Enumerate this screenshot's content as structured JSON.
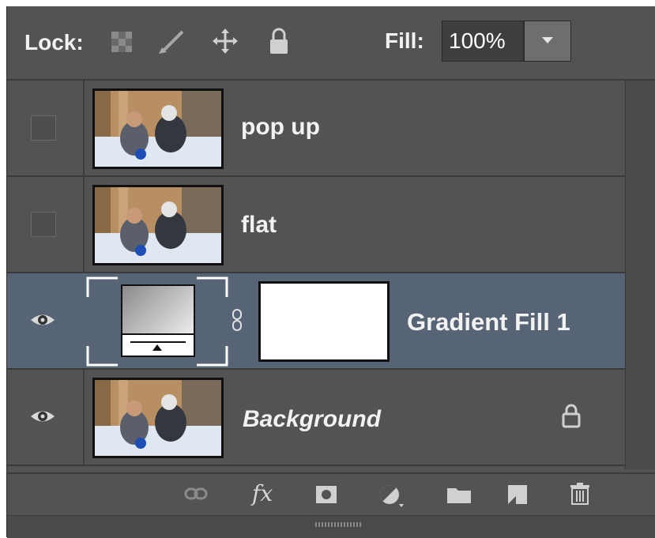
{
  "lockbar": {
    "lock_label": "Lock:",
    "lock_icons": [
      "lock-transparent-pixels-icon",
      "brush-icon",
      "move-icon",
      "padlock-icon"
    ],
    "fill_label": "Fill:",
    "fill_value": "100%"
  },
  "layers": [
    {
      "name": "pop up",
      "visible": false,
      "selected": false,
      "thumbnail": "photo"
    },
    {
      "name": "flat",
      "visible": false,
      "selected": false,
      "thumbnail": "photo"
    },
    {
      "name": "Gradient Fill 1",
      "visible": true,
      "selected": true,
      "thumbnail": "gradient-fill"
    },
    {
      "name": "Background",
      "visible": true,
      "selected": false,
      "thumbnail": "photo",
      "locked": true
    }
  ],
  "toolbar": {
    "icons": [
      "link-icon",
      "fx-icon",
      "mask-icon",
      "adjustment-icon",
      "folder-icon",
      "new-layer-icon",
      "trash-icon"
    ],
    "fx_label": "fx"
  },
  "colors": {
    "panel": "#535353",
    "selected": "#566476",
    "text": "#f2f2f2"
  }
}
